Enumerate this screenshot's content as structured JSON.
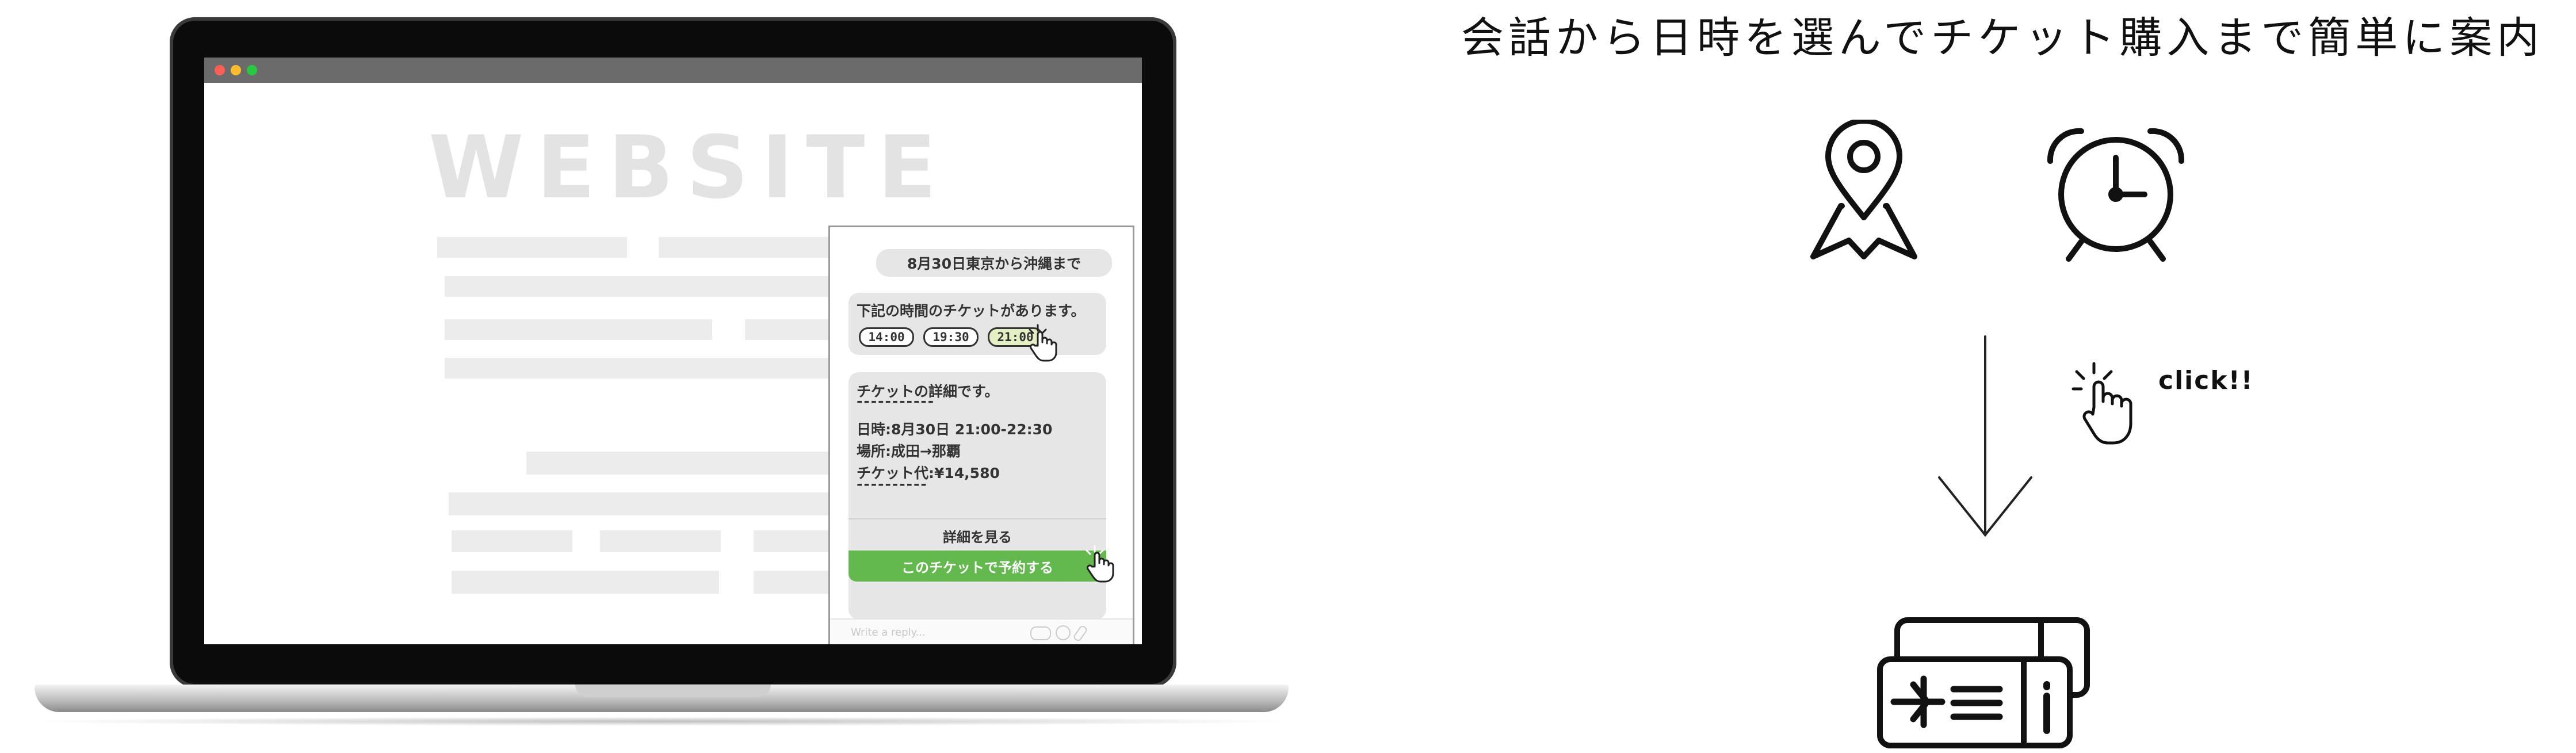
{
  "headline": "会話から日時を選んでチケット購入まで簡単に案内",
  "website_label": "WEBSITE",
  "click_label": "click!!",
  "chat": {
    "user_message": "8月30日東京から沖縄まで",
    "ticket_prompt": "下記の時間のチケットがあります。",
    "time_options": [
      "14:00",
      "19:30",
      "21:00"
    ],
    "selected_time": "21:00",
    "detail_title": "チケットの詳細です。",
    "divider": "-----------",
    "detail_date": "日時:8月30日 21:00-22:30",
    "detail_place": "場所:成田→那覇",
    "detail_price": "チケット代:¥14,580",
    "divider2": "----------",
    "view_details_button": "詳細を見る",
    "reserve_button": "このチケットで予約する",
    "reply_placeholder": "Write a reply..."
  },
  "icons": [
    "map-pin-icon",
    "alarm-clock-icon",
    "down-arrow-icon",
    "hand-click-icon",
    "plane-ticket-icon"
  ],
  "colors": {
    "accent_green": "#63b84e",
    "bubble_gray": "#e6e6e6",
    "selected_time_bg": "#e4efc4"
  }
}
